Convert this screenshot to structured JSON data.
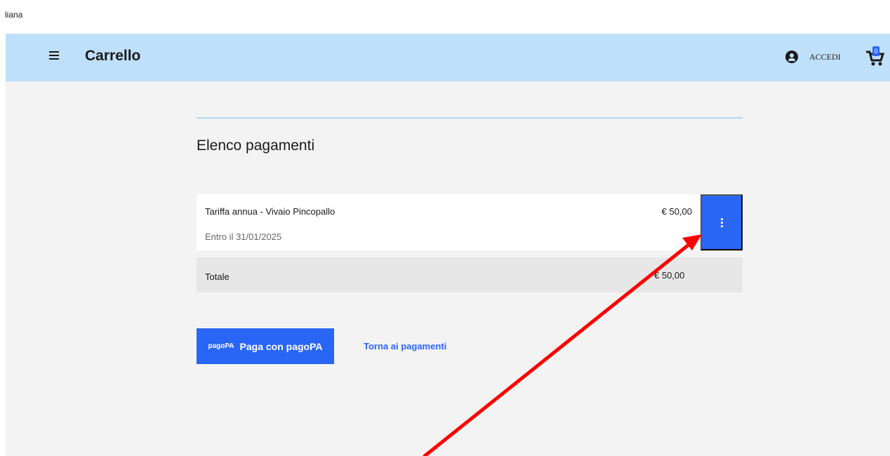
{
  "top_text": "liana",
  "header": {
    "title": "Carrello",
    "login_label": "ACCEDI",
    "cart_count": "0"
  },
  "section": {
    "title": "Elenco pagamenti"
  },
  "payments": [
    {
      "name": "Tariffa annua - Vivaio Pincopallo",
      "due": "Entro il 31/01/2025",
      "amount": "€ 50,00"
    }
  ],
  "total": {
    "label": "Totale",
    "amount": "€ 50,00"
  },
  "actions": {
    "pay_label": "Paga con pagoPA",
    "pagopa_logo": "pagoPA",
    "back_label": "Torna ai pagamenti"
  },
  "icons": {
    "menu": "hamburger-icon",
    "user": "user-circle-icon",
    "cart": "cart-icon",
    "row_menu": "vertical-dots-icon"
  },
  "colors": {
    "header_bg": "#bfe0fa",
    "accent": "#2a66f5",
    "annotation_arrow": "#ff0000"
  }
}
